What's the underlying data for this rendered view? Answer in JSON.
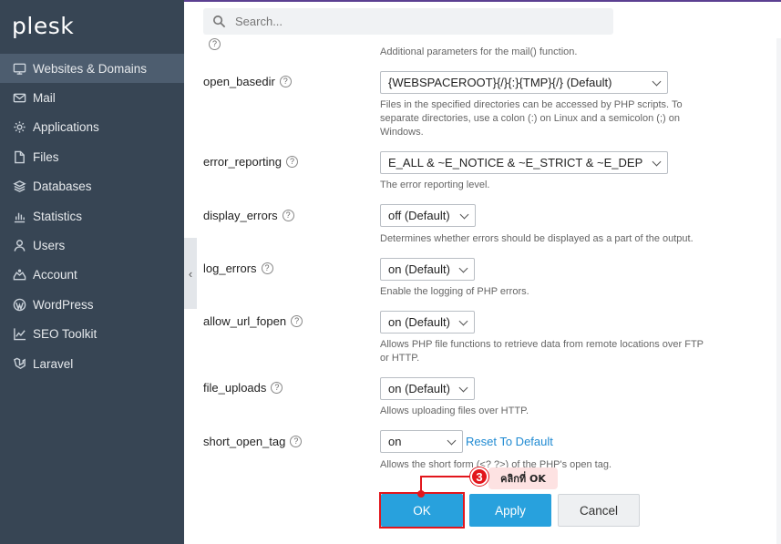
{
  "app": {
    "logo": "plesk"
  },
  "sidebar": {
    "items": [
      {
        "label": "Websites & Domains",
        "icon": "monitor-icon",
        "active": true
      },
      {
        "label": "Mail",
        "icon": "envelope-icon"
      },
      {
        "label": "Applications",
        "icon": "gear-icon"
      },
      {
        "label": "Files",
        "icon": "folder-icon"
      },
      {
        "label": "Databases",
        "icon": "database-icon"
      },
      {
        "label": "Statistics",
        "icon": "bar-chart-icon"
      },
      {
        "label": "Users",
        "icon": "user-icon"
      },
      {
        "label": "Account",
        "icon": "account-icon"
      },
      {
        "label": "WordPress",
        "icon": "wordpress-icon"
      },
      {
        "label": "SEO Toolkit",
        "icon": "seo-chart-icon"
      },
      {
        "label": "Laravel",
        "icon": "laravel-icon"
      }
    ],
    "collapse_glyph": "‹"
  },
  "search": {
    "placeholder": "Search..."
  },
  "top_desc": "Additional parameters for the mail() function.",
  "settings": {
    "open_basedir": {
      "label": "open_basedir",
      "value": "{WEBSPACEROOT}{/}{:}{TMP}{/} (Default)",
      "desc": "Files in the specified directories can be accessed by PHP scripts. To separate directories, use a colon (:) on Linux and a semicolon (;) on Windows."
    },
    "error_reporting": {
      "label": "error_reporting",
      "value": "E_ALL & ~E_NOTICE & ~E_STRICT & ~E_DEPRECATED",
      "desc": "The error reporting level."
    },
    "display_errors": {
      "label": "display_errors",
      "value": "off (Default)",
      "desc": "Determines whether errors should be displayed as a part of the output."
    },
    "log_errors": {
      "label": "log_errors",
      "value": "on (Default)",
      "desc": "Enable the logging of PHP errors."
    },
    "allow_url_fopen": {
      "label": "allow_url_fopen",
      "value": "on (Default)",
      "desc": "Allows PHP file functions to retrieve data from remote locations over FTP or HTTP."
    },
    "file_uploads": {
      "label": "file_uploads",
      "value": "on (Default)",
      "desc": "Allows uploading files over HTTP."
    },
    "short_open_tag": {
      "label": "short_open_tag",
      "value": "on",
      "reset": "Reset To Default",
      "desc": "Allows the short form (<? ?>) of the PHP's open tag."
    }
  },
  "help_glyph": "?",
  "buttons": {
    "ok": "OK",
    "apply": "Apply",
    "cancel": "Cancel"
  },
  "annotation": {
    "number": "3",
    "text": "คลิกที่ OK"
  },
  "colors": {
    "sidebar": "#374554",
    "accent": "#28a1dd",
    "annotation": "#e2161c",
    "link": "#1f8ad2"
  }
}
